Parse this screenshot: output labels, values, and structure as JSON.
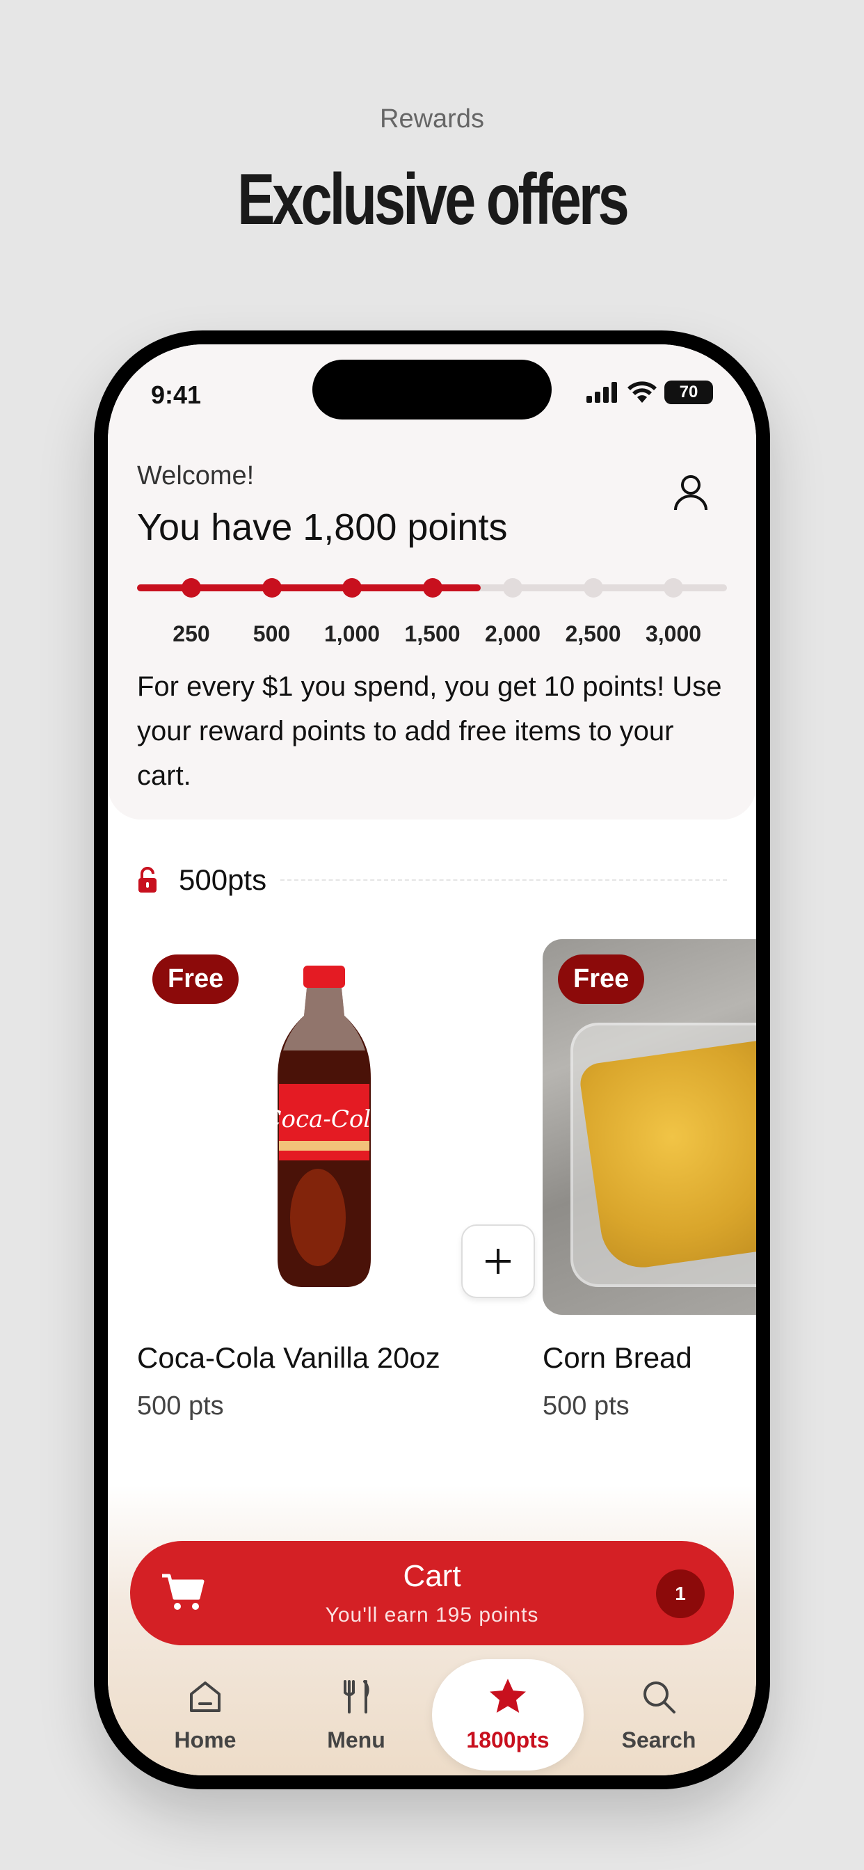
{
  "promo": {
    "eyebrow": "Rewards",
    "title": "Exclusive offers"
  },
  "status_bar": {
    "time": "9:41",
    "battery": "70"
  },
  "header": {
    "welcome": "Welcome!",
    "points_heading": "You have 1,800 points",
    "current_points": 1800,
    "max_points": 3000,
    "milestones": [
      {
        "label": "250",
        "value": 250
      },
      {
        "label": "500",
        "value": 500
      },
      {
        "label": "1,000",
        "value": 1000
      },
      {
        "label": "1,500",
        "value": 1500
      },
      {
        "label": "2,000",
        "value": 2000
      },
      {
        "label": "2,500",
        "value": 2500
      },
      {
        "label": "3,000",
        "value": 3000
      }
    ],
    "earn_text": "For every $1 you spend, you get 10 points! Use your reward points to add free items to your cart."
  },
  "tier": {
    "label": "500pts"
  },
  "products": [
    {
      "badge": "Free",
      "name": "Coca-Cola Vanilla 20oz",
      "points": "500 pts"
    },
    {
      "badge": "Free",
      "name": "Corn Bread",
      "points": "500 pts"
    }
  ],
  "cart": {
    "title": "Cart",
    "subtitle": "You'll earn 195 points",
    "count": "1"
  },
  "tabs": [
    {
      "label": "Home",
      "icon": "home-icon"
    },
    {
      "label": "Menu",
      "icon": "utensils-icon"
    },
    {
      "label": "1800pts",
      "icon": "star-icon",
      "active": true
    },
    {
      "label": "Search",
      "icon": "search-icon"
    }
  ],
  "colors": {
    "accent": "#c8101e",
    "cart": "#d42025",
    "badge": "#8c0a0a",
    "track_inactive": "#e2dcdc"
  }
}
